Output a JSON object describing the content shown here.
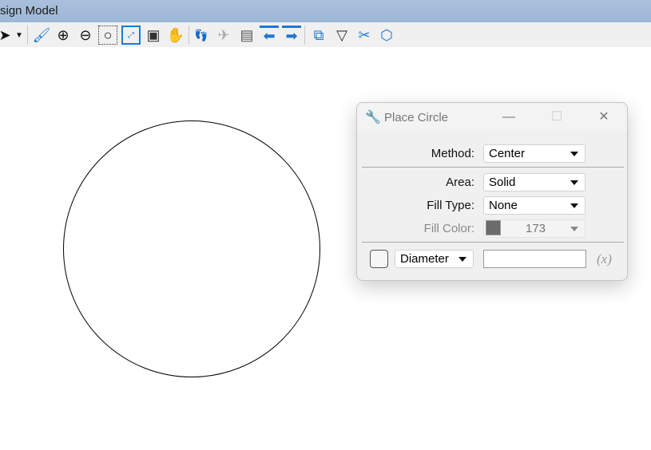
{
  "window": {
    "title": "sign Model"
  },
  "toolbar": {
    "icons": [
      "element-selection-icon",
      "dropdown-arrow-icon",
      "update-view-icon",
      "zoom-in-icon",
      "zoom-out-icon",
      "window-area-icon",
      "fit-view-icon",
      "rotate-view-icon",
      "pan-view-icon",
      "walk-icon",
      "walk-small-icon",
      "fly-icon",
      "view-previous-screen-icon",
      "previous-view-icon",
      "next-view-icon",
      "copy-view-icon",
      "view-display-mode-icon",
      "clip-volume-icon",
      "clip-mask-icon"
    ]
  },
  "dialog": {
    "title": "Place Circle",
    "method": {
      "label": "Method:",
      "value": "Center"
    },
    "area": {
      "label": "Area:",
      "value": "Solid"
    },
    "fill_type": {
      "label": "Fill Type:",
      "value": "None"
    },
    "fill_color": {
      "label": "Fill Color:",
      "value": "173",
      "swatch": "#6b6b6b"
    },
    "diameter": {
      "mode": "Diameter",
      "value": "",
      "expr": "(x)"
    }
  }
}
